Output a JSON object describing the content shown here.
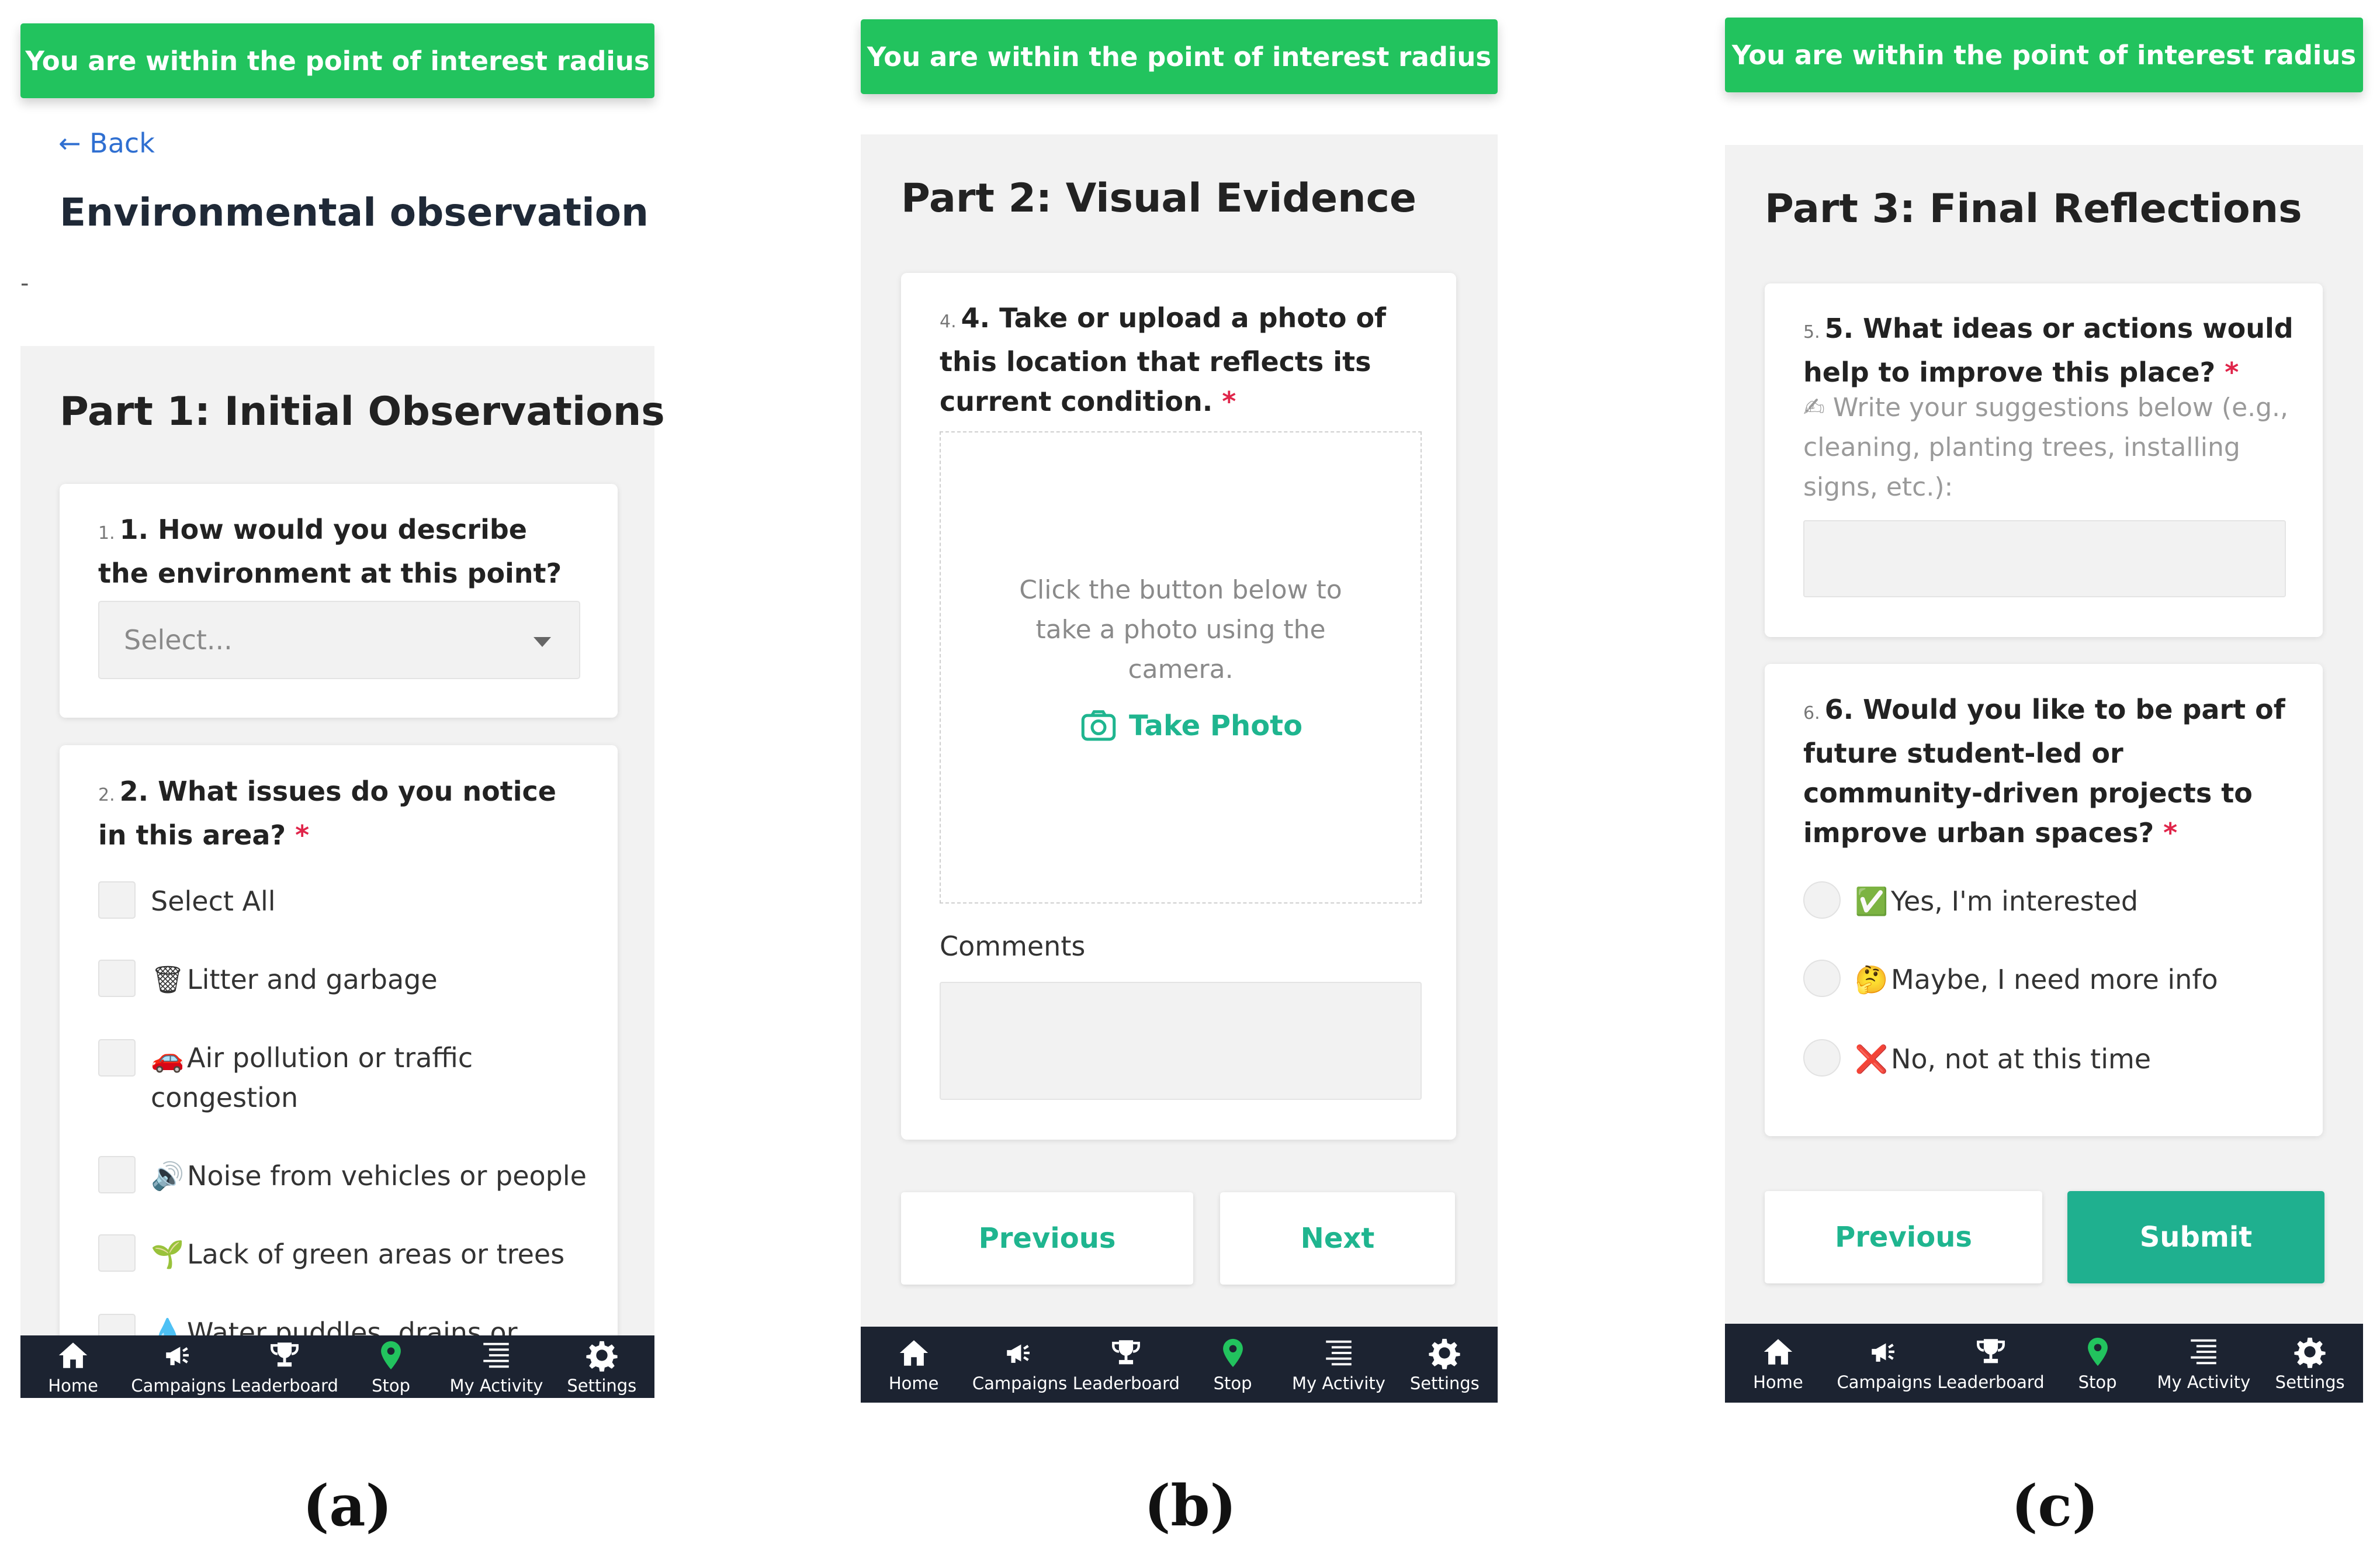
{
  "banner": "You are within the point of interest radius",
  "nav": [
    "Home",
    "Campaigns",
    "Leaderboard",
    "Stop",
    "My Activity",
    "Settings"
  ],
  "nav_icons": [
    "home-icon",
    "megaphone-icon",
    "trophy-icon",
    "map-pin-icon",
    "list-icon",
    "gear-icon"
  ],
  "colors": {
    "banner": "#22c35e",
    "accent": "#1fb08f",
    "navbar": "#1c2331",
    "required": "#e0254a"
  },
  "panel_a": {
    "back": "← Back",
    "title": "Environmental observation",
    "dash": "-",
    "part_title": "Part 1: Initial Observations",
    "q1": {
      "num": "1.",
      "text": "1. How would you describe the environment at this point?",
      "req": "*"
    },
    "select_placeholder": "Select...",
    "q2": {
      "num": "2.",
      "text": "2. What issues do you notice in this area?",
      "req": "*"
    },
    "options": [
      {
        "emoji": "",
        "label": "Select All"
      },
      {
        "emoji": "🗑",
        "label": "Litter and garbage"
      },
      {
        "emoji": "🚗",
        "label": "Air pollution or traffic congestion"
      },
      {
        "emoji": "🔊",
        "label": "Noise from vehicles or people"
      },
      {
        "emoji": "🌱",
        "label": "Lack of green areas or trees"
      },
      {
        "emoji": "💧",
        "label": "Water puddles, drains or"
      }
    ],
    "caption": "(a)"
  },
  "panel_b": {
    "part_title": "Part 2: Visual Evidence",
    "q4": {
      "num": "4.",
      "text": "4. Take or upload a photo of this location that reflects its current condition.",
      "req": "*"
    },
    "photo_hint": "Click the button below to take a photo using the camera.",
    "take_photo": "Take Photo",
    "comments_label": "Comments",
    "previous": "Previous",
    "next": "Next",
    "caption": "(b)"
  },
  "panel_c": {
    "part_title": "Part 3: Final Reflections",
    "q5": {
      "num": "5.",
      "text": "5. What ideas or actions would help to improve this place?",
      "req": "*"
    },
    "q5_hint": "✍ Write your suggestions below (e.g., cleaning, planting trees, installing signs, etc.):",
    "q6": {
      "num": "6.",
      "text": "6. Would you like to be part of future student-led or community-driven projects to improve urban spaces?",
      "req": "*"
    },
    "options": [
      {
        "emoji": "✅",
        "label": "Yes, I'm interested"
      },
      {
        "emoji": "🤔",
        "label": "Maybe, I need more info"
      },
      {
        "emoji": "❌",
        "label": "No, not at this time"
      }
    ],
    "previous": "Previous",
    "submit": "Submit",
    "caption": "(c)"
  }
}
